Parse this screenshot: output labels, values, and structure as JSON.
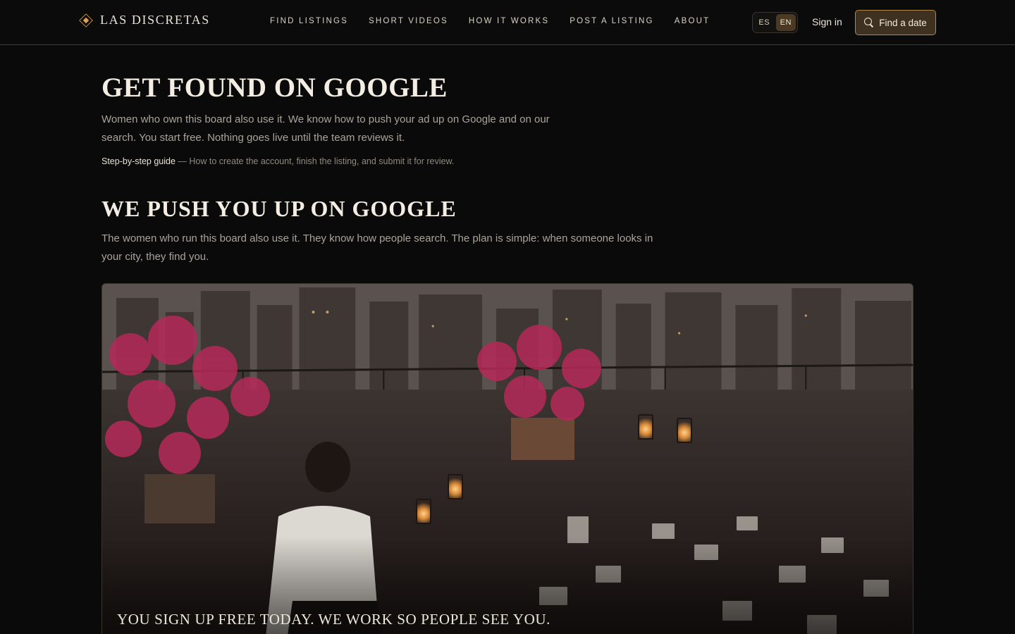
{
  "brand": {
    "name": "LAS DISCRETAS"
  },
  "nav": {
    "items": [
      {
        "label": "FIND LISTINGS"
      },
      {
        "label": "SHORT VIDEOS"
      },
      {
        "label": "HOW IT WORKS"
      },
      {
        "label": "POST A LISTING"
      },
      {
        "label": "ABOUT"
      }
    ]
  },
  "lang": {
    "options": [
      "ES",
      "EN"
    ],
    "selected": "EN"
  },
  "header": {
    "signin_label": "Sign in",
    "find_date_label": "Find a date"
  },
  "main": {
    "title": "Get found on Google",
    "lead": "Women who own this board also use it. We know how to push your ad up on Google and on our search. You start free. Nothing goes live until the team reviews it.",
    "guide_link": "Step-by-step guide",
    "guide_text": " — How to create the account, finish the listing, and submit it for review.",
    "section_title": "We push you up on Google",
    "section_text": "The women who run this board also use it. They know how people search. The plan is simple: when someone looks in your city, they find you.",
    "hero_caption": "You sign up free today. We work so people see you."
  },
  "colors": {
    "accent": "#b3884c",
    "background": "#0b0a0a",
    "flowers": "#b52a5a"
  },
  "icons": {
    "brand": "diamond-logo-icon",
    "search": "search-icon"
  }
}
